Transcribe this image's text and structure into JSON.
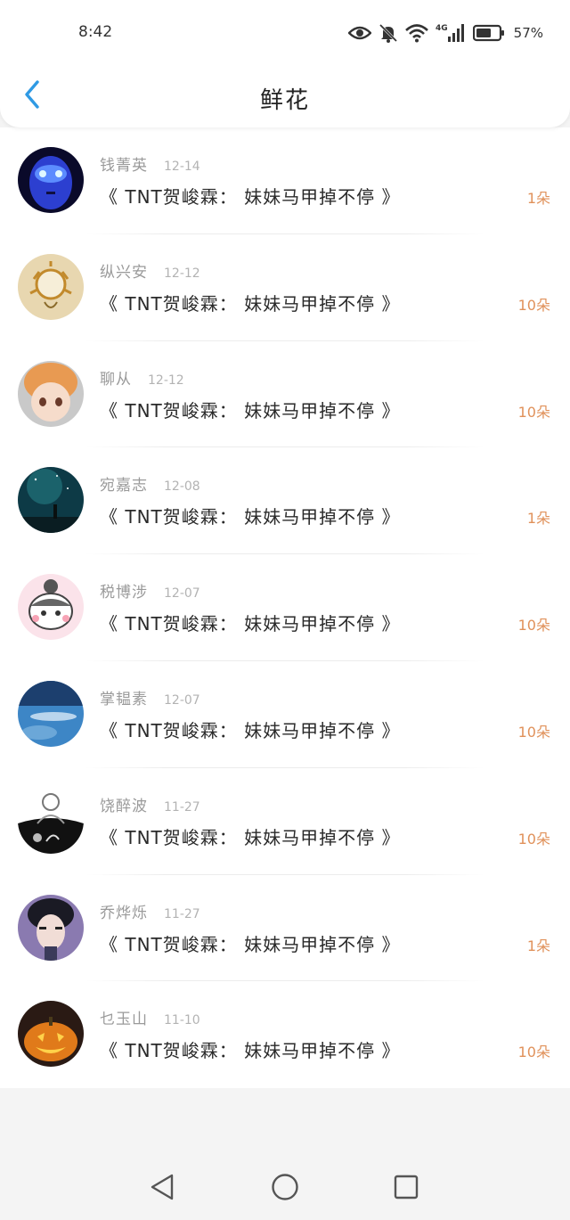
{
  "status_bar": {
    "time": "8:42",
    "battery": "57%",
    "icons": [
      "eye-icon",
      "bell-muted-icon",
      "wifi-icon",
      "4g-signal-icon",
      "battery-icon"
    ]
  },
  "header": {
    "title": "鲜花",
    "back_icon": "chevron-left-icon"
  },
  "colors": {
    "accent": "#2f9ae4",
    "amount": "#e0915a",
    "name": "#9a9a9a",
    "date": "#b3b3b3"
  },
  "items": [
    {
      "name": "钱菁英",
      "date": "12-14",
      "title": "《 TNT贺峻霖： 妹妹马甲掉不停 》",
      "amount": "1朵"
    },
    {
      "name": "纵兴安",
      "date": "12-12",
      "title": "《 TNT贺峻霖： 妹妹马甲掉不停 》",
      "amount": "10朵"
    },
    {
      "name": "聊从",
      "date": "12-12",
      "title": "《 TNT贺峻霖： 妹妹马甲掉不停 》",
      "amount": "10朵"
    },
    {
      "name": "宛嘉志",
      "date": "12-08",
      "title": "《 TNT贺峻霖： 妹妹马甲掉不停 》",
      "amount": "1朵"
    },
    {
      "name": "税博涉",
      "date": "12-07",
      "title": "《 TNT贺峻霖： 妹妹马甲掉不停 》",
      "amount": "10朵"
    },
    {
      "name": "掌韫素",
      "date": "12-07",
      "title": "《 TNT贺峻霖： 妹妹马甲掉不停 》",
      "amount": "10朵"
    },
    {
      "name": "饶醉波",
      "date": "11-27",
      "title": "《 TNT贺峻霖： 妹妹马甲掉不停 》",
      "amount": "10朵"
    },
    {
      "name": "乔烨烁",
      "date": "11-27",
      "title": "《 TNT贺峻霖： 妹妹马甲掉不停 》",
      "amount": "1朵"
    },
    {
      "name": "乜玉山",
      "date": "11-10",
      "title": "《 TNT贺峻霖： 妹妹马甲掉不停 》",
      "amount": "10朵"
    }
  ],
  "system_nav": [
    "back-triangle-icon",
    "home-circle-icon",
    "recents-square-icon"
  ]
}
